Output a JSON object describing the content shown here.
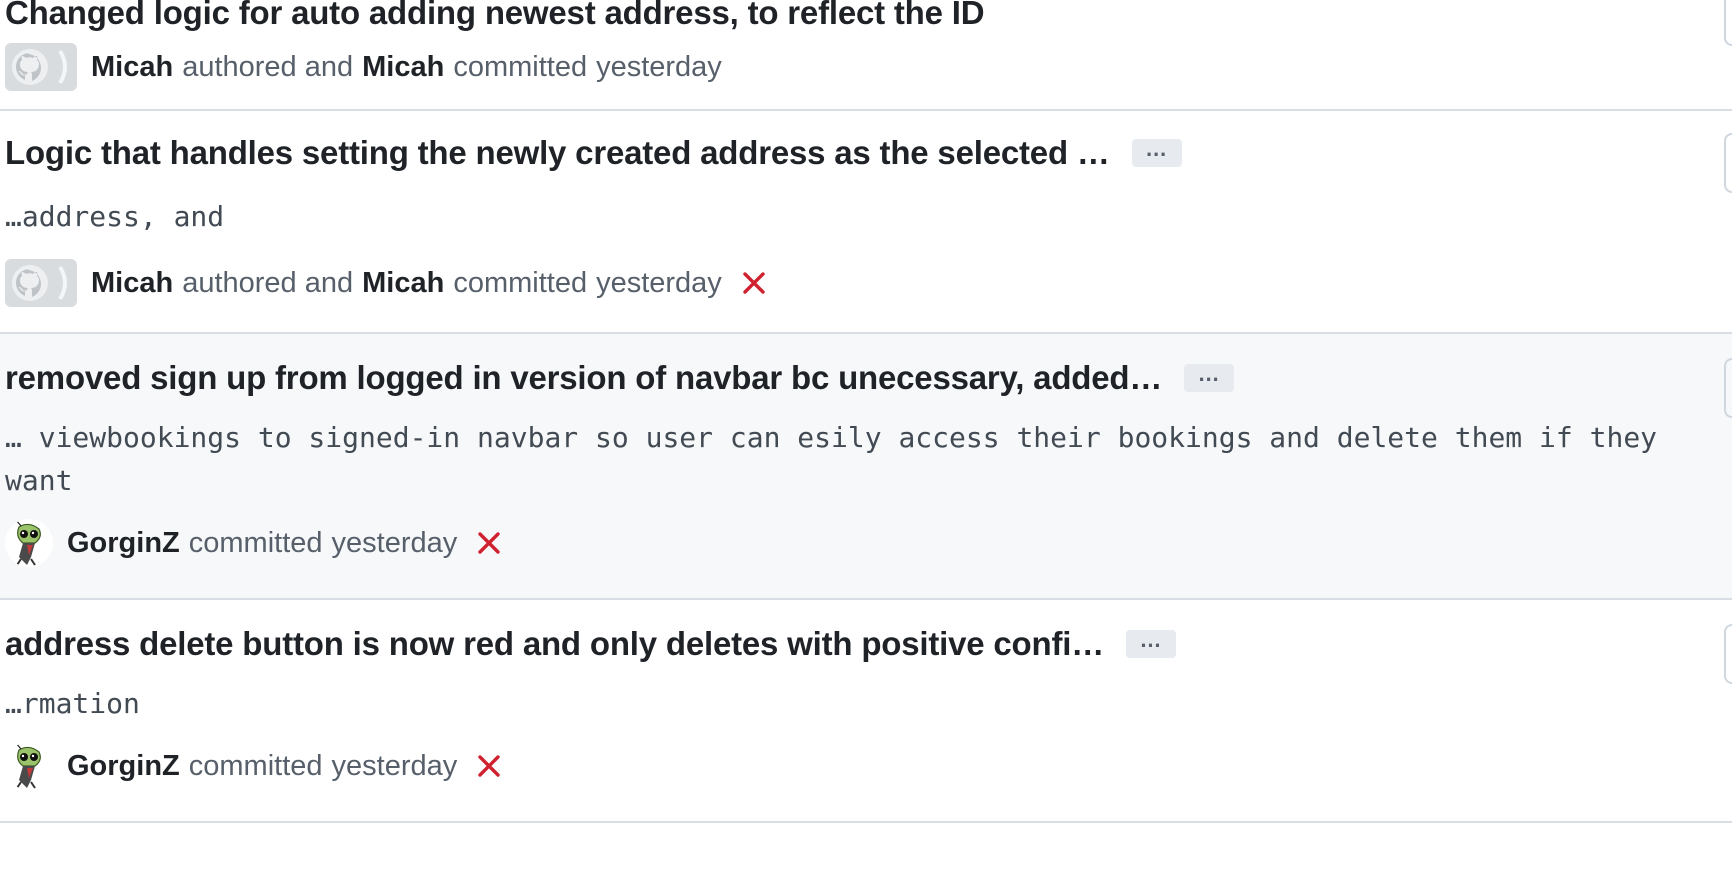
{
  "commits": [
    {
      "title": "Changed logic for auto adding newest address, to reflect the ID",
      "description": "",
      "has_expander": false,
      "author": "Micah",
      "authored_text": "authored and",
      "committer": "Micah",
      "committed_text": "committed",
      "time": "yesterday",
      "status": "none",
      "avatar": "github-default-avatar"
    },
    {
      "title": "Logic that handles setting the newly created address as the selected …",
      "description": "…address, and",
      "has_expander": true,
      "expander_label": "…",
      "author": "Micah",
      "authored_text": "authored and",
      "committer": "Micah",
      "committed_text": "committed",
      "time": "yesterday",
      "status": "failure",
      "avatar": "github-default-avatar"
    },
    {
      "title": "removed sign up from logged in version of navbar bc unecessary, added…",
      "description": "… viewbookings to signed-in navbar so user can esily access their bookings and delete them if they want",
      "has_expander": true,
      "expander_label": "…",
      "committer": "GorginZ",
      "committed_text": "committed",
      "time": "yesterday",
      "status": "failure",
      "avatar": "zim-avatar"
    },
    {
      "title": "address delete button is now red and only deletes with positive confi…",
      "description": "…rmation",
      "has_expander": true,
      "expander_label": "…",
      "committer": "GorginZ",
      "committed_text": "committed",
      "time": "yesterday",
      "status": "failure",
      "avatar": "zim-avatar"
    }
  ],
  "colors": {
    "failure": "#cf222e",
    "border": "#d8dee4",
    "highlight_bg": "#f6f8fa",
    "muted_text": "#57606a"
  }
}
